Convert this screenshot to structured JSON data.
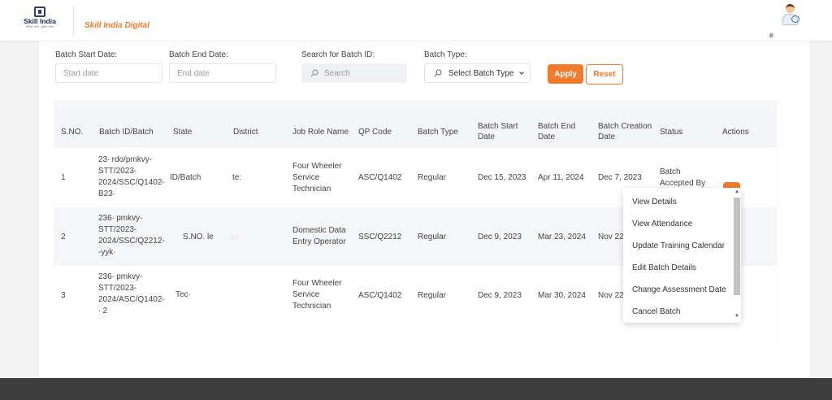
{
  "header": {
    "logo": {
      "name": "Skill India",
      "tagline": "कौशल भारत - कुशल भारत"
    },
    "brand": "Skill India Digital",
    "user_initial": "e"
  },
  "filters": {
    "start_date": {
      "label": "Batch Start Date:",
      "placeholder": "Start date"
    },
    "end_date": {
      "label": "Batch End Date:",
      "placeholder": "End date"
    },
    "search": {
      "label": "Search for Batch ID:",
      "placeholder": "Search"
    },
    "batch_type": {
      "label": "Batch Type:",
      "value": "Select Batch Type"
    },
    "apply": "Apply",
    "reset": "Reset"
  },
  "table": {
    "headers": {
      "sno": "S.NO.",
      "batch_id": "Batch ID/Batch",
      "state": "State",
      "district": "District",
      "job_role": "Job Role Name",
      "qp_code": "QP Code",
      "batch_type": "Batch Type",
      "start_date": [
        "Batch Start",
        "Date"
      ],
      "end_date": [
        "Batch End",
        "Date"
      ],
      "creation_date": [
        "Batch Creation",
        "Date"
      ],
      "status": "Status",
      "actions": "Actions"
    },
    "rows": [
      {
        "sno": "1",
        "batch_id": [
          "23∙ rdo/pmkvy-",
          "STT/2023-",
          "2024/SSC/Q1402-",
          "B23∙"
        ],
        "state": "ID/Batch",
        "district": "te:",
        "job_role": [
          "Four Wheeler",
          "Service",
          "Technician"
        ],
        "qp_code": "ASC/Q1402",
        "batch_type": "Regular",
        "start_date": "Dec 15, 2023",
        "end_date": "Apr 11, 2024",
        "creation_date": "Dec 7, 2023",
        "status": [
          "Batch",
          "Accepted By"
        ]
      },
      {
        "sno": "2",
        "batch_id": [
          "236∙ pmkvy-",
          "STT/2023-",
          "2024/SSC/Q2212-",
          "-yyk∙"
        ],
        "state": "S.NO. le",
        "district": "∙ ∙",
        "job_role": [
          "Domestic Data",
          "Entry Operator"
        ],
        "qp_code": "SSC/Q2212",
        "batch_type": "Regular",
        "start_date": "Dec 9, 2023",
        "end_date": "Mar 23, 2024",
        "creation_date": "Nov 22,",
        "status": []
      },
      {
        "sno": "3",
        "batch_id": [
          "236∙ pmkvy-",
          "STT/2023-",
          "2024/ASC/Q1402-",
          "∙ 2"
        ],
        "state": "Tec∙",
        "district": "",
        "job_role": [
          "Four Wheeler",
          "Service",
          "Technician"
        ],
        "qp_code": "ASC/Q1402",
        "batch_type": "Regular",
        "start_date": "Dec 9, 2023",
        "end_date": "Mar 30, 2024",
        "creation_date": "Nov 22,",
        "status": []
      }
    ]
  },
  "actions_menu": {
    "button_label": "···",
    "items": [
      "View Details",
      "View Attendance",
      "Update Training Calendar",
      "Edit Batch Details",
      "Change Assessment Date",
      "Cancel Batch"
    ]
  },
  "colors": {
    "accent": "#f07b2c",
    "footer": "#3d3d3d",
    "header_row": "#f4f5f8"
  }
}
